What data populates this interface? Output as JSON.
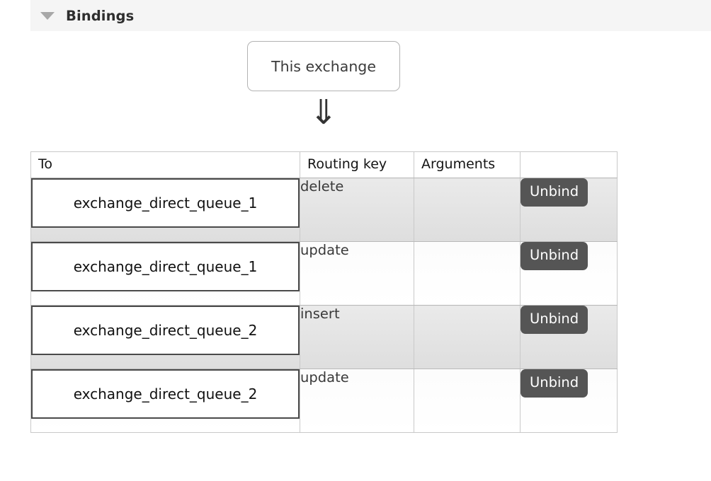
{
  "section": {
    "title": "Bindings",
    "toggle_icon": "triangle-down-icon",
    "expanded": true
  },
  "source_node": {
    "label": "This exchange",
    "arrow_glyph": "⇓"
  },
  "table": {
    "columns": [
      "To",
      "Routing key",
      "Arguments",
      ""
    ],
    "action_label": "Unbind",
    "rows": [
      {
        "to": "exchange_direct_queue_1",
        "routing_key": "delete",
        "arguments": "",
        "action": "Unbind"
      },
      {
        "to": "exchange_direct_queue_1",
        "routing_key": "update",
        "arguments": "",
        "action": "Unbind"
      },
      {
        "to": "exchange_direct_queue_2",
        "routing_key": "insert",
        "arguments": "",
        "action": "Unbind"
      },
      {
        "to": "exchange_direct_queue_2",
        "routing_key": "update",
        "arguments": "",
        "action": "Unbind"
      }
    ]
  },
  "colors": {
    "header_bg": "#f5f5f5",
    "button_bg": "#555555",
    "row_odd_bg": "#e4e4e4",
    "row_even_bg": "#ffffff",
    "border": "#c9c9c9",
    "queue_box_border": "#4a4a4a"
  }
}
